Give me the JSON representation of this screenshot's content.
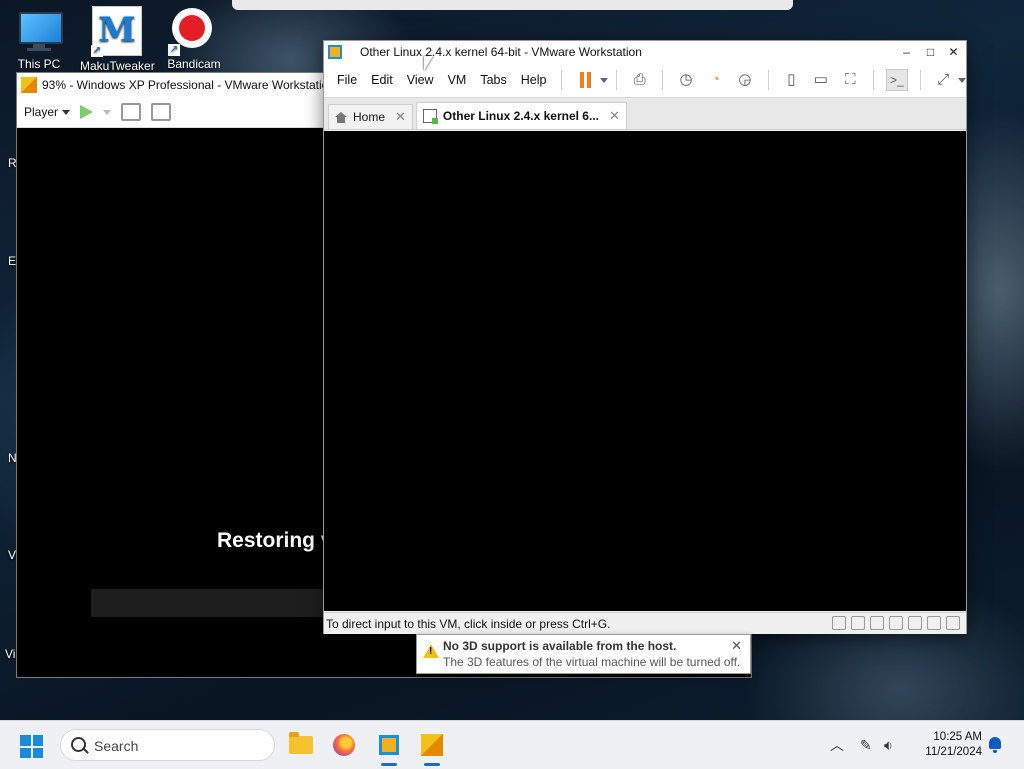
{
  "desktop": {
    "icons": [
      {
        "label": "This PC",
        "icon": "monitor-icon"
      },
      {
        "label": "MakuTweaker",
        "icon": "makutweaker-icon"
      },
      {
        "label": "Bandicam",
        "icon": "bandicam-record-icon"
      }
    ],
    "left_edge_clips": [
      "R",
      "E",
      "N",
      "V",
      "Vi"
    ]
  },
  "xp_window": {
    "title": "93% - Windows XP Professional - VMware Workstation",
    "player_menu": "Player",
    "restoring_text": "Restoring v"
  },
  "workstation": {
    "title": "Other Linux 2.4.x kernel 64-bit - VMware Workstation",
    "window_controls": {
      "minimize": "–",
      "maximize": "□",
      "close": "✕"
    },
    "menu": [
      "File",
      "Edit",
      "View",
      "VM",
      "Tabs",
      "Help"
    ],
    "tabs": [
      {
        "label": "Home",
        "active": false
      },
      {
        "label": "Other Linux 2.4.x kernel 6...",
        "active": true
      }
    ],
    "status_message": "To direct input to this VM, click inside or press Ctrl+G."
  },
  "notification": {
    "title": "No 3D support is available from the host.",
    "body": "The 3D features of the virtual machine will be turned off."
  },
  "taskbar": {
    "search_placeholder": "Search",
    "time": "10:25 AM",
    "date": "11/21/2024",
    "pinned": [
      "file-explorer-icon",
      "firefox-icon",
      "vmware-workstation-icon",
      "vmware-player-icon"
    ]
  },
  "colors": {
    "pause_orange": "#f07f1a",
    "play_green": "#7ecb6b",
    "vmware_blue": "#1d8fd8",
    "accent_blue": "#1a6fc4"
  }
}
